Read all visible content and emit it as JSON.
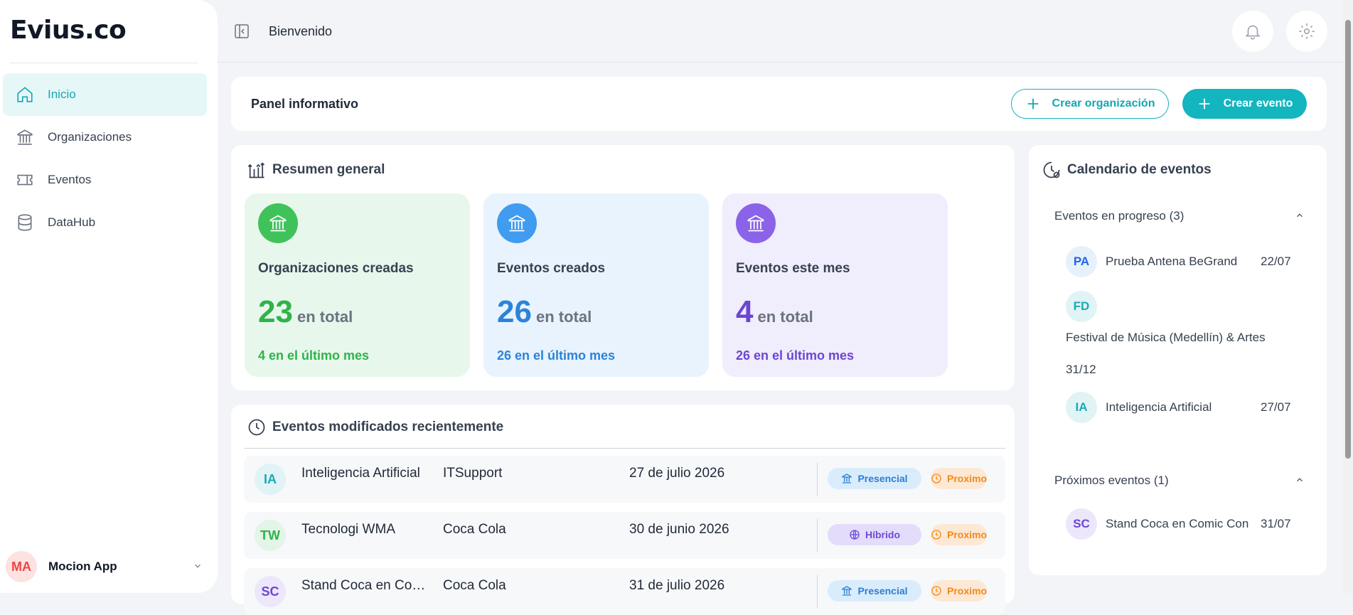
{
  "sidebar": {
    "logo": "Evius.co",
    "items": [
      {
        "label": "Inicio",
        "icon": "home-icon",
        "active": true
      },
      {
        "label": "Organizaciones",
        "icon": "building-icon",
        "active": false
      },
      {
        "label": "Eventos",
        "icon": "ticket-icon",
        "active": false
      },
      {
        "label": "DataHub",
        "icon": "database-icon",
        "active": false
      }
    ],
    "user": {
      "initials": "MA",
      "name": "Mocion App"
    }
  },
  "header": {
    "title": "Bienvenido"
  },
  "panel": {
    "title": "Panel informativo",
    "create_org_label": "Crear organización",
    "create_event_label": "Crear evento"
  },
  "summary": {
    "title": "Resumen general",
    "cards": [
      {
        "label": "Organizaciones creadas",
        "value": "23",
        "unit": "en total",
        "sub": "4 en el último mes",
        "color": "#2fb34a"
      },
      {
        "label": "Eventos creados",
        "value": "26",
        "unit": "en total",
        "sub": "26 en el último mes",
        "color": "#2b83d9"
      },
      {
        "label": "Eventos este mes",
        "value": "4",
        "unit": "en total",
        "sub": "26 en el último mes",
        "color": "#6d45d4"
      }
    ]
  },
  "recent": {
    "title": "Eventos modificados recientemente",
    "rows": [
      {
        "initials": "IA",
        "name": "Inteligencia Artificial",
        "org": "ITSupport",
        "date": "27 de julio 2026",
        "type": "Presencial",
        "status": "Proximo"
      },
      {
        "initials": "TW",
        "name": "Tecnologi WMA",
        "org": "Coca Cola",
        "date": "30 de junio 2026",
        "type": "Híbrido",
        "status": "Proximo"
      },
      {
        "initials": "SC",
        "name": "Stand Coca en Comic Con",
        "org": "Coca Cola",
        "date": "31 de julio 2026",
        "type": "Presencial",
        "status": "Proximo"
      }
    ]
  },
  "calendar": {
    "title": "Calendario de eventos",
    "in_progress_label": "Eventos en progreso (3)",
    "in_progress": [
      {
        "initials": "PA",
        "name": "Prueba Antena BeGrand",
        "date": "22/07"
      },
      {
        "initials": "FD",
        "name": "Festival de Música (Medellín) & Artes",
        "date": "31/12"
      },
      {
        "initials": "IA",
        "name": "Inteligencia Artificial",
        "date": "27/07"
      }
    ],
    "upcoming_label": "Próximos eventos (1)",
    "upcoming": [
      {
        "initials": "SC",
        "name": "Stand Coca en Comic Con",
        "date": "31/07"
      }
    ]
  }
}
